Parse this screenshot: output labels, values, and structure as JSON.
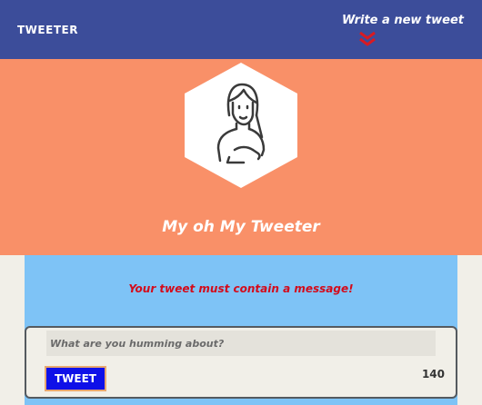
{
  "header": {
    "logo": "TWEETER",
    "compose_link": "Write a new tweet",
    "compose_icon": "double-chevron-down-icon"
  },
  "profile": {
    "name": "My oh My Tweeter",
    "avatar_icon": "woman-avatar-icon"
  },
  "compose": {
    "error": "Your tweet must contain a message!",
    "placeholder": "What are you humming about?",
    "value": "",
    "button_label": "TWEET",
    "char_count": "140"
  },
  "colors": {
    "nav": "#3c4d9a",
    "hero": "#f99068",
    "compose_bg": "#7ec3f6",
    "error": "#d30b1b",
    "button": "#0f10e8",
    "page_bg": "#f1efe8"
  }
}
